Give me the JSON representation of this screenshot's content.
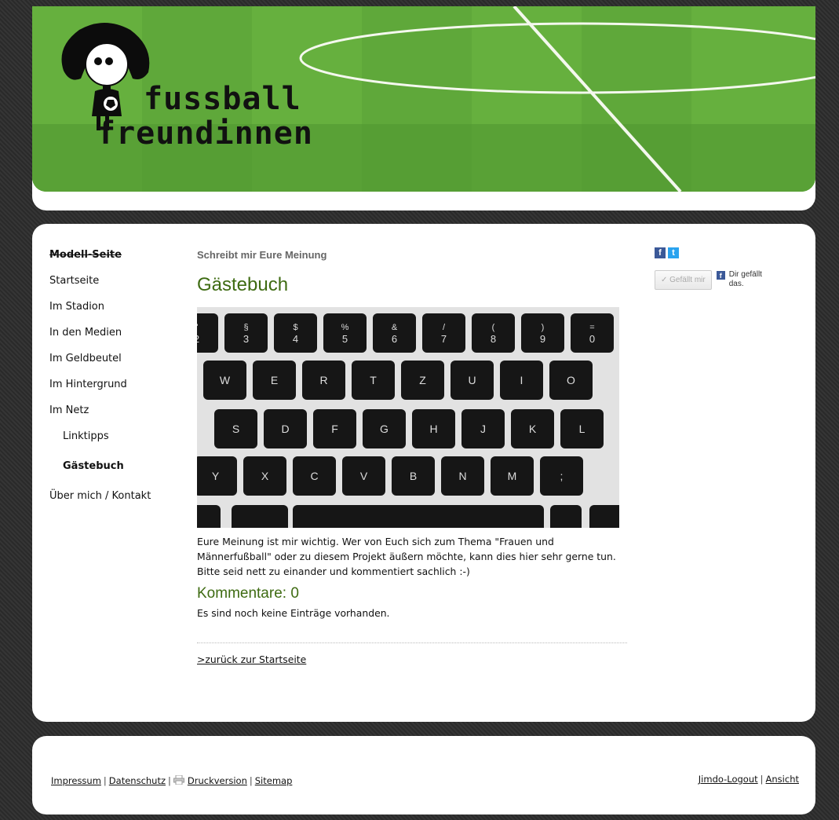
{
  "header": {
    "logo_line1": "fussball",
    "logo_line2": "freundinnen"
  },
  "sidebar": {
    "items": [
      {
        "label": "Modell-Seite"
      },
      {
        "label": "Startseite"
      },
      {
        "label": "Im Stadion"
      },
      {
        "label": "In den Medien"
      },
      {
        "label": "Im Geldbeutel"
      },
      {
        "label": "Im Hintergrund"
      },
      {
        "label": "Im Netz"
      },
      {
        "label": "Linktipps"
      },
      {
        "label": "Gästebuch"
      },
      {
        "label": "Über mich / Kontakt"
      }
    ]
  },
  "main": {
    "subtitle": "Schreibt mir Eure Meinung",
    "title": "Gästebuch",
    "intro": "Eure Meinung ist mir wichtig. Wer von Euch sich zum Thema \"Frauen und Männerfußball\" oder zu diesem Projekt äußern möchte, kann dies hier sehr gerne tun. Bitte seid nett zu einander und kommentiert sachlich :-)",
    "comments_title": "Kommentare: 0",
    "no_entries": "Es sind noch keine Einträge vorhanden.",
    "back_link": ">zurück zur Startseite"
  },
  "keyboard": {
    "row1": [
      [
        "\"",
        "2"
      ],
      [
        "§",
        "3"
      ],
      [
        "$",
        "4"
      ],
      [
        "%",
        "5"
      ],
      [
        "&",
        "6"
      ],
      [
        "/",
        "7"
      ],
      [
        "(",
        "8"
      ],
      [
        ")",
        "9"
      ],
      [
        "=",
        "0"
      ]
    ],
    "row2": [
      "W",
      "E",
      "R",
      "T",
      "Z",
      "U",
      "I",
      "O"
    ],
    "row3": [
      "S",
      "D",
      "F",
      "G",
      "H",
      "J",
      "K",
      "L"
    ],
    "row4": [
      "Y",
      "X",
      "C",
      "V",
      "B",
      "N",
      "M",
      ";"
    ]
  },
  "right": {
    "fb_letter": "f",
    "tw_letter": "t",
    "like_button": "✓ Gefällt mir",
    "like_text": "Dir gefällt das."
  },
  "footer": {
    "impressum": "Impressum",
    "datenschutz": "Datenschutz",
    "druckversion": "Druckversion",
    "sitemap": "Sitemap",
    "sep": "|",
    "logout": "Jimdo-Logout",
    "ansicht": "Ansicht"
  },
  "colors": {
    "accent_green": "#3e6b12",
    "facebook": "#3b5998",
    "twitter": "#2aa3ef"
  }
}
